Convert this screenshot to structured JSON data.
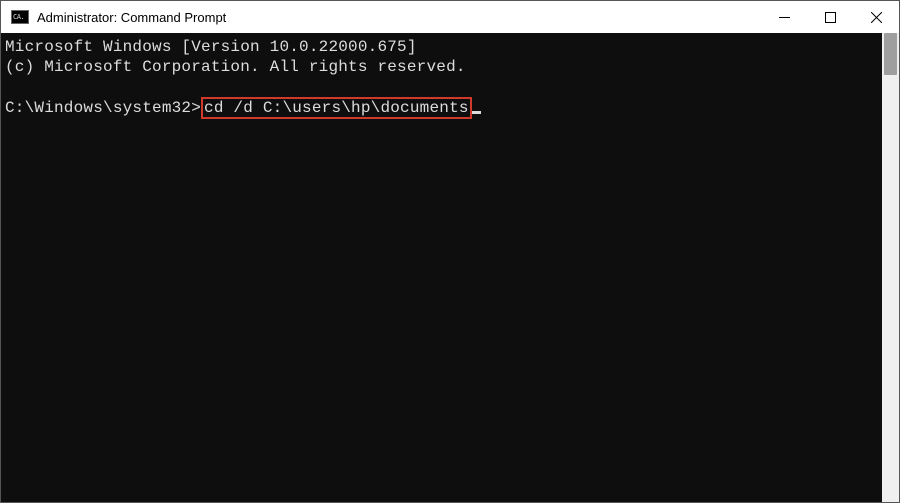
{
  "titlebar": {
    "icon_label": "CA.",
    "title": "Administrator: Command Prompt"
  },
  "terminal": {
    "line1": "Microsoft Windows [Version 10.0.22000.675]",
    "line2": "(c) Microsoft Corporation. All rights reserved.",
    "prompt": "C:\\Windows\\system32>",
    "command": "cd /d C:\\users\\hp\\documents"
  }
}
